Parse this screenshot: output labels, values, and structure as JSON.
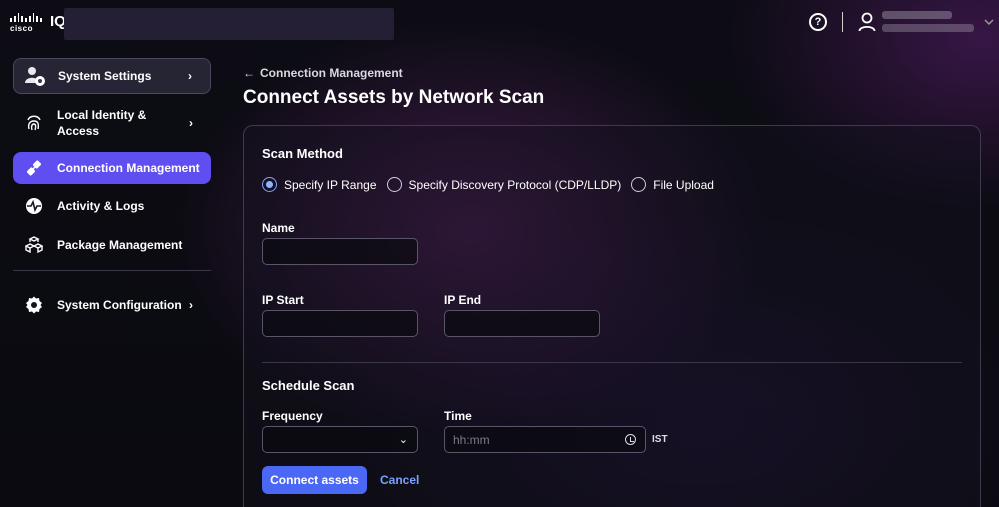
{
  "header": {
    "brand": "cisco",
    "product": "IQ"
  },
  "sidebar": {
    "items": [
      {
        "label": "System Settings",
        "icon": "user-gear-icon"
      },
      {
        "label": "Local Identity & Access",
        "icon": "fingerprint-icon"
      },
      {
        "label": "Connection Management",
        "icon": "plug-icon"
      },
      {
        "label": "Activity & Logs",
        "icon": "activity-icon"
      },
      {
        "label": "Package Management",
        "icon": "packages-icon"
      },
      {
        "label": "System Configuration",
        "icon": "gear-icon"
      }
    ]
  },
  "main": {
    "back_label": "Connection Management",
    "title": "Connect Assets by Network Scan",
    "scan_method": {
      "title": "Scan Method",
      "options": [
        "Specify IP Range",
        "Specify Discovery Protocol (CDP/LLDP)",
        "File Upload"
      ],
      "selected": "Specify IP Range"
    },
    "fields": {
      "name_label": "Name",
      "ip_start_label": "IP Start",
      "ip_end_label": "IP End"
    },
    "schedule": {
      "title": "Schedule Scan",
      "frequency_label": "Frequency",
      "time_label": "Time",
      "time_placeholder": "hh:mm",
      "timezone": "IST"
    },
    "actions": {
      "primary": "Connect assets",
      "secondary": "Cancel"
    }
  },
  "colors": {
    "accent": "#5f4ef0",
    "primary_button": "#4a67f5",
    "link": "#7aa2ff"
  }
}
